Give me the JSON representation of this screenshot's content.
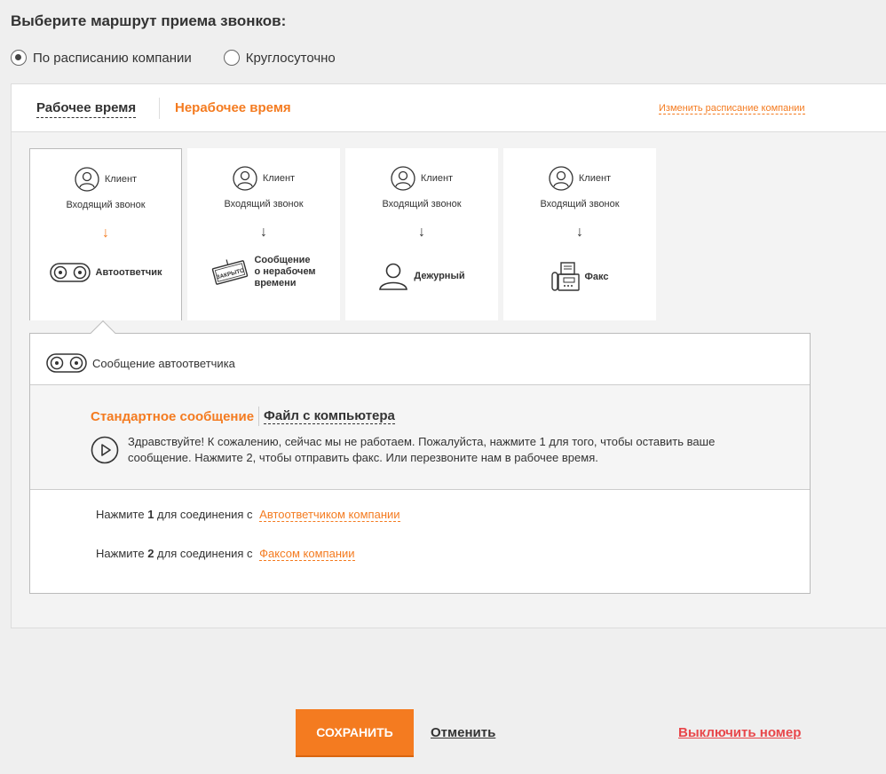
{
  "page": {
    "title": "Выберите маршрут приема звонков:"
  },
  "schedule_options": [
    {
      "label": "По расписанию компании",
      "checked": true
    },
    {
      "label": "Круглосуточно",
      "checked": false
    }
  ],
  "tabs": {
    "work": "Рабочее время",
    "nonwork": "Нерабочее время",
    "change_link": "Изменить расписание компании"
  },
  "cards": [
    {
      "client": "Клиент",
      "incoming": "Входящий звонок",
      "arrow": "↓",
      "dest": "Автоответчик",
      "icon": "tape-icon",
      "active": true
    },
    {
      "client": "Клиент",
      "incoming": "Входящий звонок",
      "arrow": "↓",
      "dest": "Сообщение о нерабочем времени",
      "dest_lines": [
        "Сообщение",
        "о нерабочем",
        "времени"
      ],
      "icon": "closed-sign-icon",
      "sign_text": "ЗАКРЫТО",
      "active": false
    },
    {
      "client": "Клиент",
      "incoming": "Входящий звонок",
      "arrow": "↓",
      "dest": "Дежурный",
      "icon": "person-icon",
      "active": false
    },
    {
      "client": "Клиент",
      "incoming": "Входящий звонок",
      "arrow": "↓",
      "dest": "Факс",
      "icon": "fax-icon",
      "active": false
    }
  ],
  "detail": {
    "title": "Сообщение автоответчика",
    "tab_standard": "Стандартное сообщение",
    "tab_file": "Файл с компьютера",
    "message": "Здравствуйте! К сожалению, сейчас мы не работаем. Пожалуйста, нажмите 1 для того, чтобы оставить ваше сообщение. Нажмите 2, чтобы отправить факс. Или перезвоните нам в рабочее время.",
    "press_prefix": "Нажмите",
    "press_mid": "для соединения с",
    "options": [
      {
        "key": "1",
        "target": "Автоответчиком компании"
      },
      {
        "key": "2",
        "target": "Факсом компании"
      }
    ]
  },
  "actions": {
    "save": "СОХРАНИТЬ",
    "cancel": "Отменить",
    "disable": "Выключить номер"
  },
  "colors": {
    "accent": "#f47b20",
    "danger": "#e8464a"
  }
}
